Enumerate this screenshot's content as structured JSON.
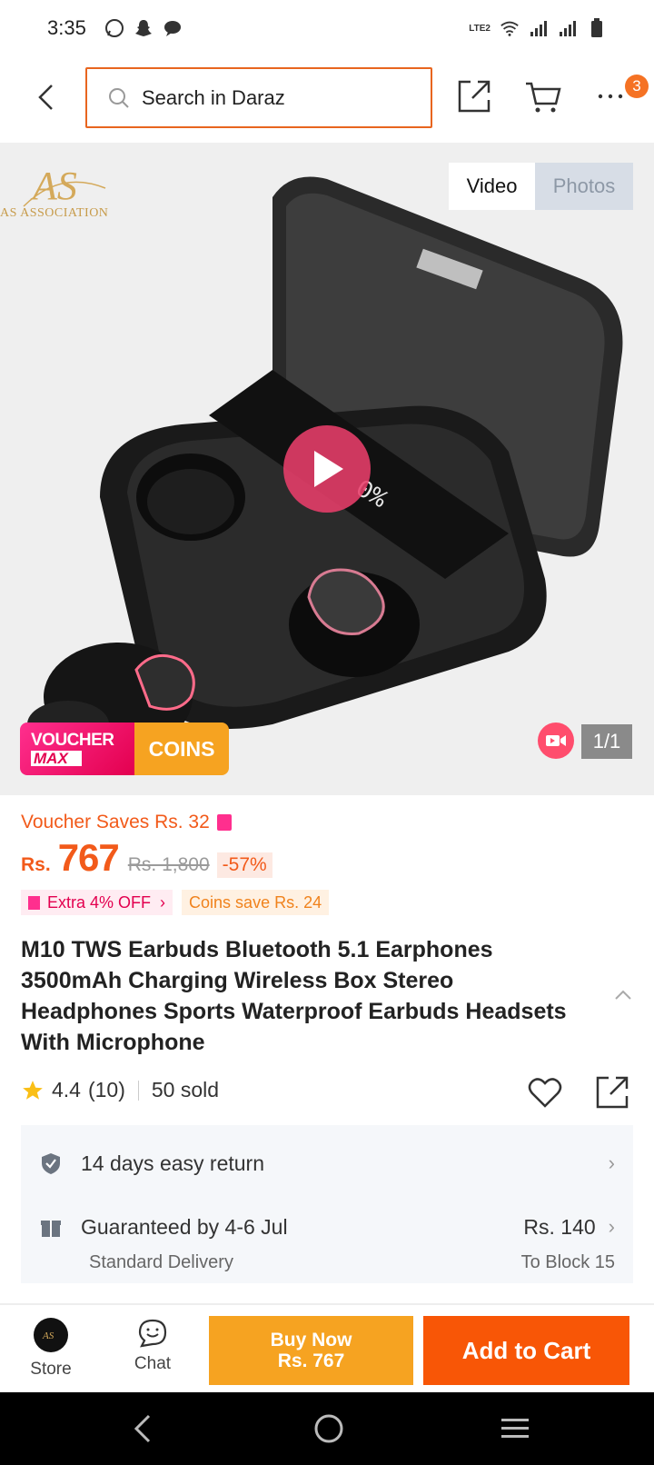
{
  "status_bar": {
    "time": "3:35",
    "lte_label": "LTE2"
  },
  "header": {
    "search_placeholder": "Search in Daraz",
    "more_badge_count": "3"
  },
  "media": {
    "seller_logo_text": "AS ASSOCIATION",
    "tabs": [
      {
        "label": "Video",
        "active": true
      },
      {
        "label": "Photos",
        "active": false
      }
    ],
    "voucher_badge": {
      "line1": "VOUCHER",
      "line2": "MAX",
      "coins": "COINS"
    },
    "page_counter": "1/1"
  },
  "pricing": {
    "voucher_saves": "Voucher Saves Rs. 32",
    "currency": "Rs.",
    "price": "767",
    "old_price": "Rs. 1,800",
    "discount": "-57%",
    "promo_extra": "Extra 4% OFF",
    "promo_coins": "Coins save Rs. 24"
  },
  "product": {
    "title": "M10 TWS Earbuds Bluetooth 5.1 Earphones 3500mAh Charging Wireless Box Stereo Headphones Sports Waterproof Earbuds Headsets With Microphone",
    "rating": "4.4",
    "rating_count": "(10)",
    "sold": "50 sold"
  },
  "services": {
    "return_policy": "14 days easy return",
    "delivery_guarantee": "Guaranteed by 4-6 Jul",
    "delivery_price": "Rs. 140",
    "delivery_type": "Standard Delivery",
    "delivery_location": "To Block 15"
  },
  "action_bar": {
    "store_label": "Store",
    "chat_label": "Chat",
    "buy_now_label": "Buy Now",
    "buy_now_price": "Rs. 767",
    "add_to_cart_label": "Add to Cart"
  },
  "colors": {
    "brand_orange": "#f85606",
    "price_orange": "#f25a1a",
    "buy_now_yellow": "#f6a321",
    "voucher_pink": "#e3004f"
  }
}
